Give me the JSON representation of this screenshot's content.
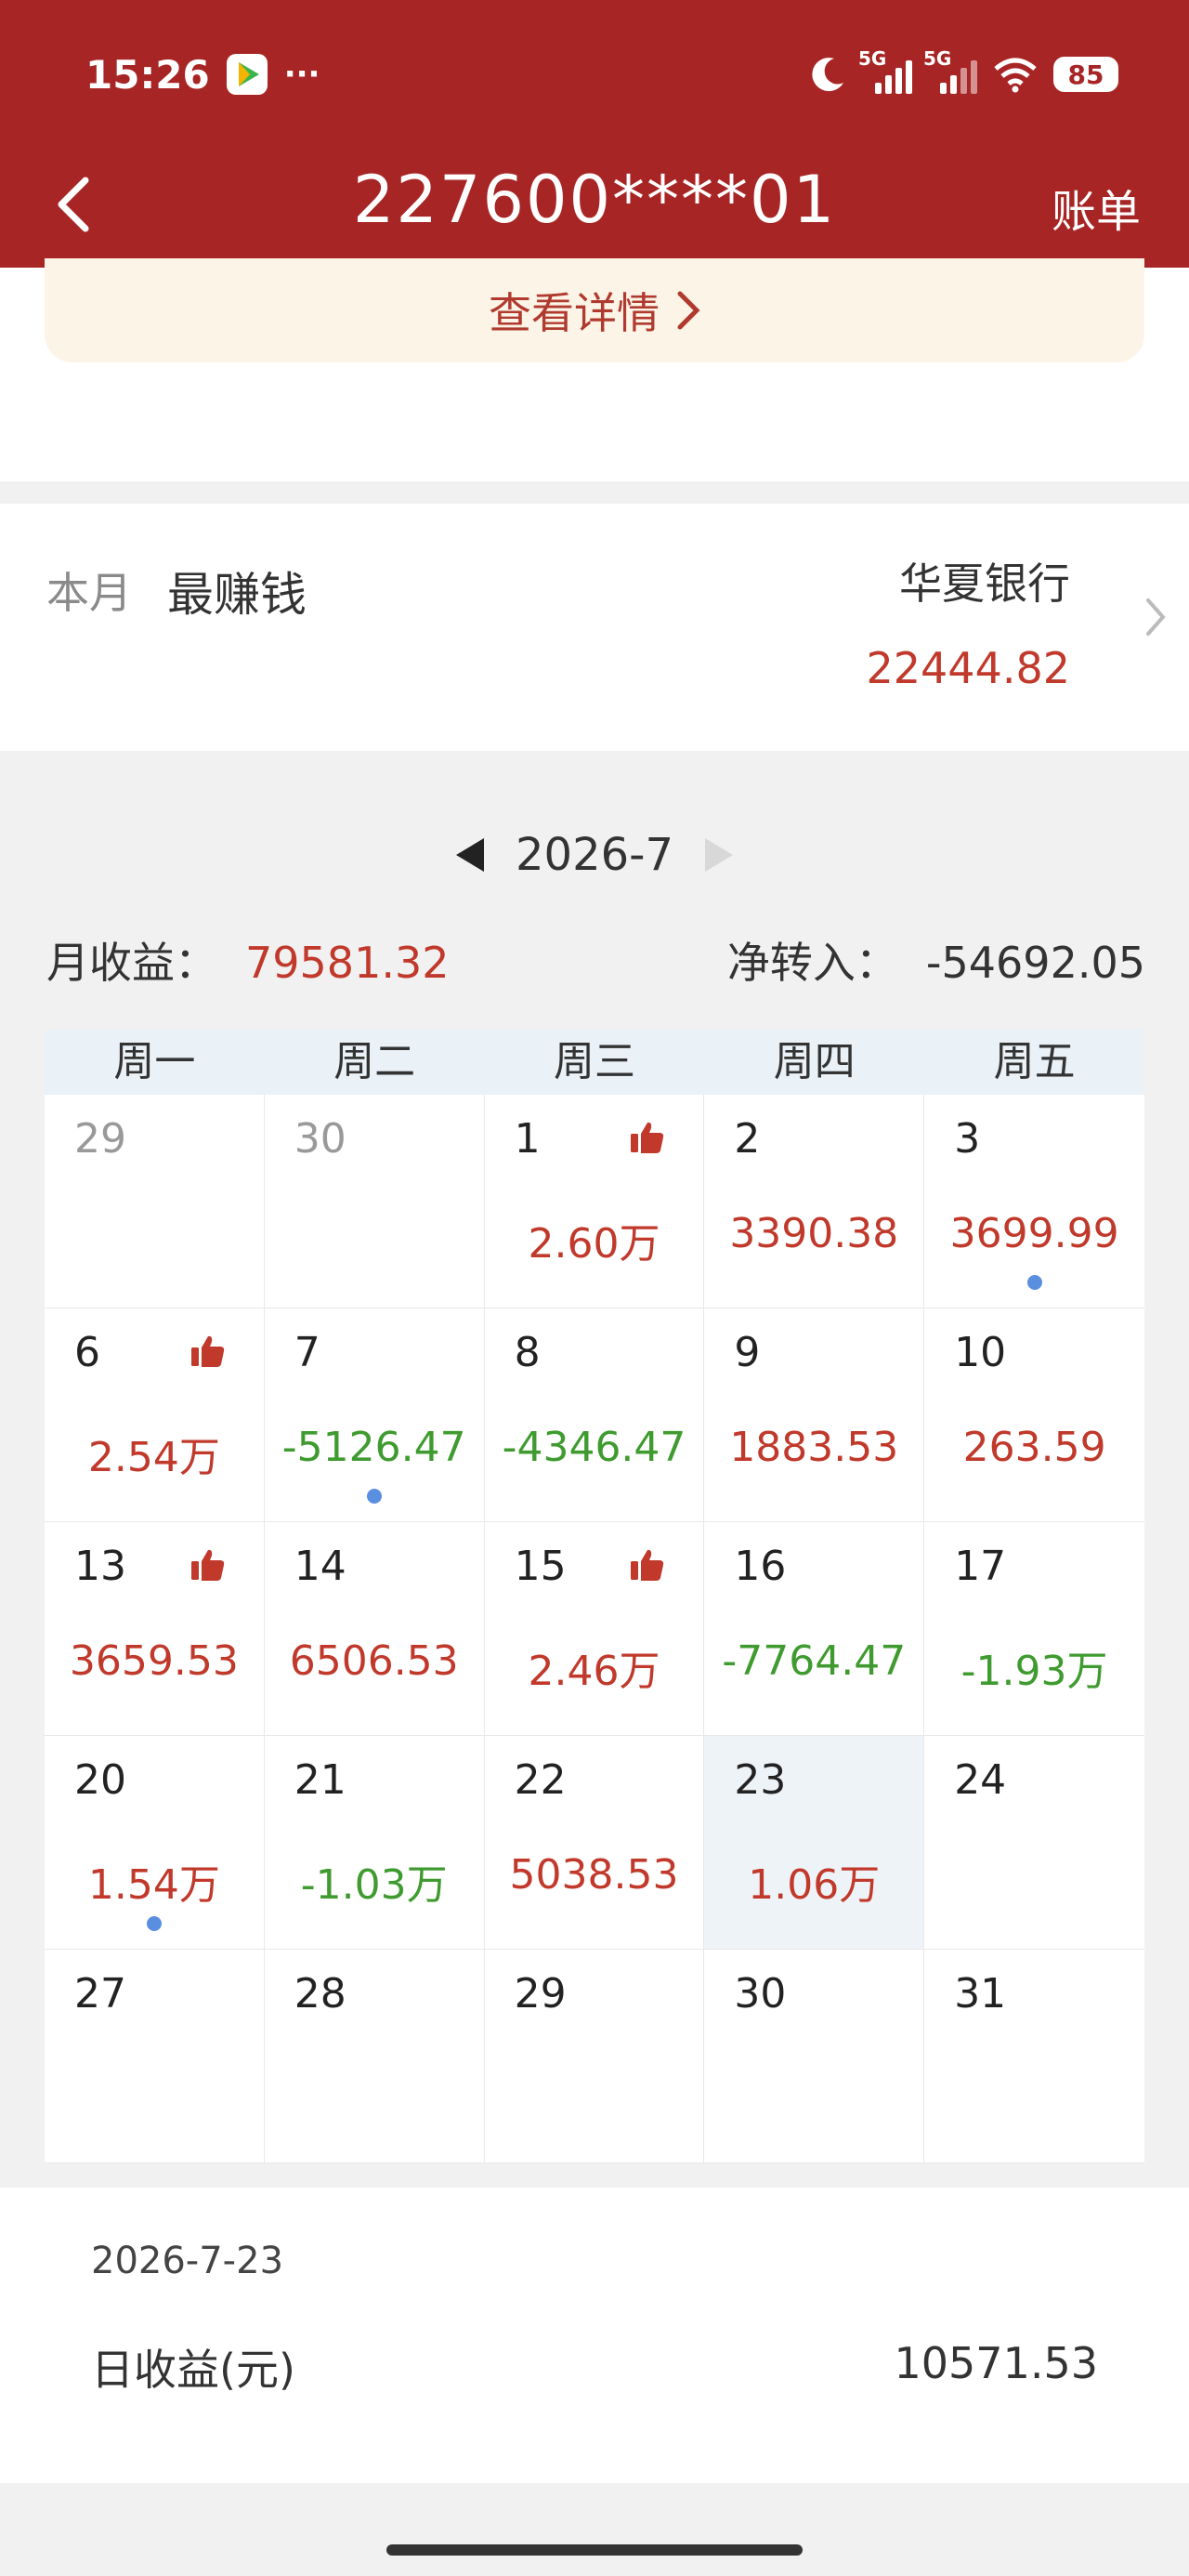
{
  "status_bar": {
    "time": "15:26",
    "dots": "···",
    "net_left": "5G",
    "net_right": "5G",
    "battery": "85"
  },
  "nav": {
    "title": "227600****01",
    "action": "账单"
  },
  "banner": {
    "link_text": "查看详情"
  },
  "best": {
    "month_label": "本月",
    "label": "最赚钱",
    "name": "华夏银行",
    "value": "22444.82"
  },
  "calendar": {
    "month": "2026-7",
    "month_income_label": "月收益：",
    "month_income": "79581.32",
    "net_transfer_label": "净转入：",
    "net_transfer": "-54692.05",
    "weekdays": [
      "周一",
      "周二",
      "周三",
      "周四",
      "周五"
    ],
    "cells": [
      {
        "day": "29",
        "value": "",
        "tone": "",
        "muted": true,
        "thumb": false,
        "dot": false
      },
      {
        "day": "30",
        "value": "",
        "tone": "",
        "muted": true,
        "thumb": false,
        "dot": false
      },
      {
        "day": "1",
        "value": "2.60万",
        "tone": "pos",
        "muted": false,
        "thumb": true,
        "dot": false
      },
      {
        "day": "2",
        "value": "3390.38",
        "tone": "pos",
        "muted": false,
        "thumb": false,
        "dot": false
      },
      {
        "day": "3",
        "value": "3699.99",
        "tone": "pos",
        "muted": false,
        "thumb": false,
        "dot": true
      },
      {
        "day": "6",
        "value": "2.54万",
        "tone": "pos",
        "muted": false,
        "thumb": true,
        "dot": false
      },
      {
        "day": "7",
        "value": "-5126.47",
        "tone": "neg",
        "muted": false,
        "thumb": false,
        "dot": true
      },
      {
        "day": "8",
        "value": "-4346.47",
        "tone": "neg",
        "muted": false,
        "thumb": false,
        "dot": false
      },
      {
        "day": "9",
        "value": "1883.53",
        "tone": "pos",
        "muted": false,
        "thumb": false,
        "dot": false
      },
      {
        "day": "10",
        "value": "263.59",
        "tone": "pos",
        "muted": false,
        "thumb": false,
        "dot": false
      },
      {
        "day": "13",
        "value": "3659.53",
        "tone": "pos",
        "muted": false,
        "thumb": true,
        "dot": false
      },
      {
        "day": "14",
        "value": "6506.53",
        "tone": "pos",
        "muted": false,
        "thumb": false,
        "dot": false
      },
      {
        "day": "15",
        "value": "2.46万",
        "tone": "pos",
        "muted": false,
        "thumb": true,
        "dot": false
      },
      {
        "day": "16",
        "value": "-7764.47",
        "tone": "neg",
        "muted": false,
        "thumb": false,
        "dot": false
      },
      {
        "day": "17",
        "value": "-1.93万",
        "tone": "neg",
        "muted": false,
        "thumb": false,
        "dot": false
      },
      {
        "day": "20",
        "value": "1.54万",
        "tone": "pos",
        "muted": false,
        "thumb": false,
        "dot": true
      },
      {
        "day": "21",
        "value": "-1.03万",
        "tone": "neg",
        "muted": false,
        "thumb": false,
        "dot": false
      },
      {
        "day": "22",
        "value": "5038.53",
        "tone": "pos",
        "muted": false,
        "thumb": false,
        "dot": false
      },
      {
        "day": "23",
        "value": "1.06万",
        "tone": "pos",
        "muted": false,
        "thumb": false,
        "dot": false,
        "selected": true
      },
      {
        "day": "24",
        "value": "",
        "tone": "",
        "muted": false,
        "thumb": false,
        "dot": false
      },
      {
        "day": "27",
        "value": "",
        "tone": "",
        "muted": false,
        "thumb": false,
        "dot": false
      },
      {
        "day": "28",
        "value": "",
        "tone": "",
        "muted": false,
        "thumb": false,
        "dot": false
      },
      {
        "day": "29",
        "value": "",
        "tone": "",
        "muted": false,
        "thumb": false,
        "dot": false
      },
      {
        "day": "30",
        "value": "",
        "tone": "",
        "muted": false,
        "thumb": false,
        "dot": false
      },
      {
        "day": "31",
        "value": "",
        "tone": "",
        "muted": false,
        "thumb": false,
        "dot": false
      }
    ]
  },
  "detail": {
    "date": "2026-7-23",
    "label": "日收益(元)",
    "value": "10571.53"
  },
  "colors": {
    "brand": "#a82525",
    "positive": "#c0392b",
    "negative": "#3f9b2f",
    "dot": "#5a8fe0"
  },
  "icons": [
    "back-chevron-icon",
    "thumbs-up-icon",
    "chevron-right-icon",
    "moon-icon",
    "wifi-icon",
    "signal-icon"
  ]
}
